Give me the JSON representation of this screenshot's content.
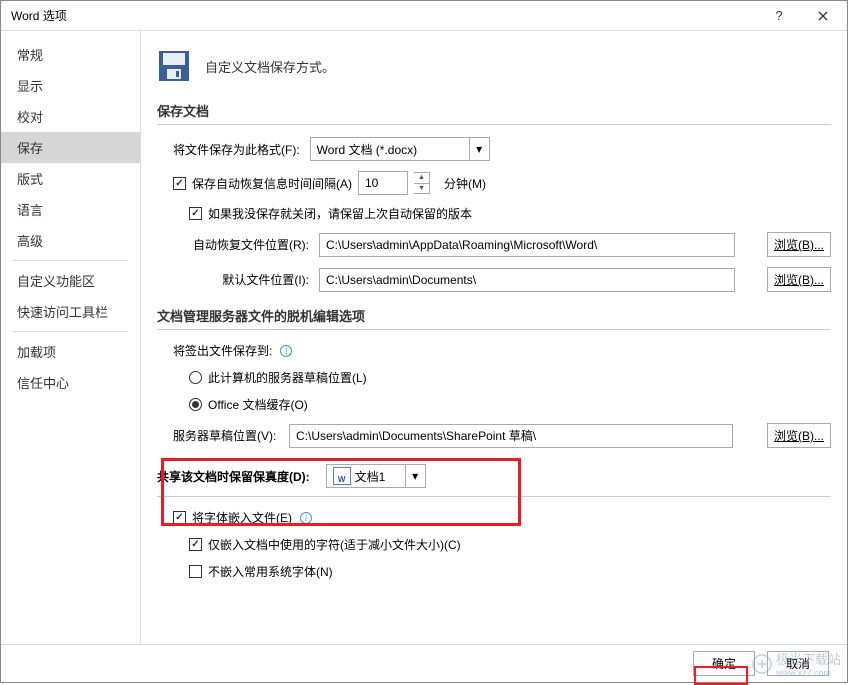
{
  "titlebar": {
    "title": "Word 选项"
  },
  "sidebar": {
    "items": [
      {
        "label": "常规"
      },
      {
        "label": "显示"
      },
      {
        "label": "校对"
      },
      {
        "label": "保存",
        "selected": true
      },
      {
        "label": "版式"
      },
      {
        "label": "语言"
      },
      {
        "label": "高级"
      }
    ],
    "items2": [
      {
        "label": "自定义功能区"
      },
      {
        "label": "快速访问工具栏"
      }
    ],
    "items3": [
      {
        "label": "加载项"
      },
      {
        "label": "信任中心"
      }
    ]
  },
  "header": {
    "title": "自定义文档保存方式。"
  },
  "section1": {
    "title": "保存文档",
    "format_label": "将文件保存为此格式(F):",
    "format_value": "Word 文档 (*.docx)",
    "autosave_label": "保存自动恢复信息时间间隔(A)",
    "autosave_value": "10",
    "autosave_unit": "分钟(M)",
    "keep_last_label": "如果我没保存就关闭，请保留上次自动保留的版本",
    "autorecover_loc_label": "自动恢复文件位置(R):",
    "autorecover_loc_value": "C:\\Users\\admin\\AppData\\Roaming\\Microsoft\\Word\\",
    "default_loc_label": "默认文件位置(I):",
    "default_loc_value": "C:\\Users\\admin\\Documents\\",
    "browse_label": "浏览(B)..."
  },
  "section2": {
    "title": "文档管理服务器文件的脱机编辑选项",
    "save_checkout_label": "将签出文件保存到:",
    "radio1_label": "此计算机的服务器草稿位置(L)",
    "radio2_label": "Office 文档缓存(O)",
    "server_draft_label": "服务器草稿位置(V):",
    "server_draft_value": "C:\\Users\\admin\\Documents\\SharePoint 草稿\\",
    "browse_label": "浏览(B)..."
  },
  "section3": {
    "label": "共享该文档时保留保真度(D):",
    "doc_name": "文档1",
    "embed_fonts_label": "将字体嵌入文件(E)",
    "embed_used_label": "仅嵌入文档中使用的字符(适于减小文件大小)(C)",
    "no_common_label": "不嵌入常用系统字体(N)"
  },
  "footer": {
    "ok": "确定",
    "cancel": "取消"
  },
  "watermark": {
    "text": "极光下载站",
    "url": "www.xz7.com"
  }
}
